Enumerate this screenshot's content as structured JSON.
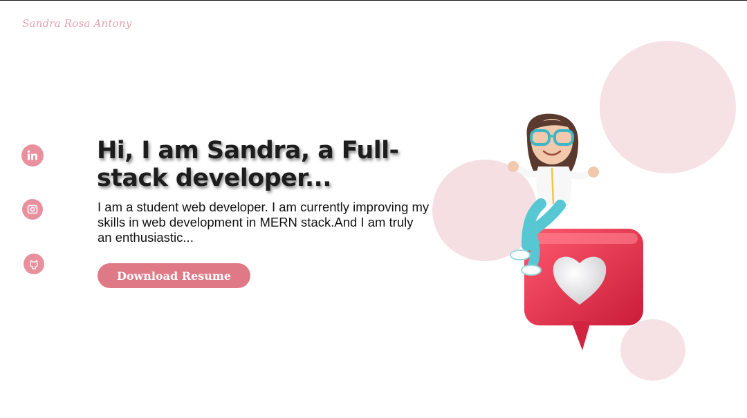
{
  "brand": {
    "name": "Sandra Rosa Antony"
  },
  "social": [
    {
      "name": "linkedin",
      "icon": "linkedin-icon"
    },
    {
      "name": "instagram",
      "icon": "instagram-icon"
    },
    {
      "name": "github",
      "icon": "github-icon"
    }
  ],
  "hero": {
    "headline": "Hi, I am Sandra, a Full-stack developer...",
    "intro": "I am a student web developer. I am currently improving my skills in web development in MERN stack.And I am truly an enthusiastic...",
    "download_label": "Download Resume"
  },
  "colors": {
    "accent": "#e07986",
    "blob": "#f6e2e5",
    "text": "#111111",
    "heart_bubble": "#e8344d"
  }
}
